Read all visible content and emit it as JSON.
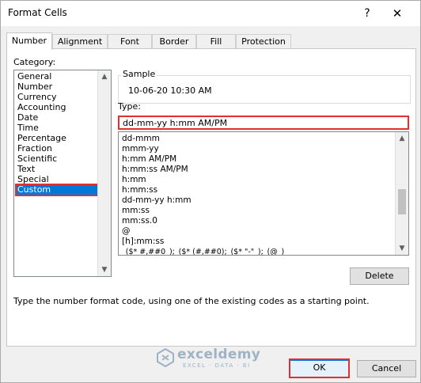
{
  "window": {
    "title": "Format Cells",
    "help": "?",
    "close": "✕"
  },
  "tabs": [
    {
      "label": "Number",
      "active": true
    },
    {
      "label": "Alignment"
    },
    {
      "label": "Font"
    },
    {
      "label": "Border"
    },
    {
      "label": "Fill"
    },
    {
      "label": "Protection"
    }
  ],
  "category": {
    "label": "Category:",
    "items": [
      "General",
      "Number",
      "Currency",
      "Accounting",
      "Date",
      "Time",
      "Percentage",
      "Fraction",
      "Scientific",
      "Text",
      "Special",
      "Custom"
    ],
    "selected": "Custom"
  },
  "sample": {
    "label": "Sample",
    "value": "10-06-20 10:30 AM"
  },
  "type": {
    "label": "Type:",
    "value": "dd-mm-yy h:mm AM/PM",
    "list": [
      "dd-mmm",
      "mmm-yy",
      "h:mm AM/PM",
      "h:mm:ss AM/PM",
      "h:mm",
      "h:mm:ss",
      "dd-mm-yy h:mm",
      "mm:ss",
      "mm:ss.0",
      "@",
      "[h]:mm:ss",
      "_($* #,##0_);_($* (#,##0);_($* \"-\"_);_(@_)"
    ]
  },
  "buttons": {
    "delete": "Delete",
    "ok": "OK",
    "cancel": "Cancel"
  },
  "hint": "Type the number format code, using one of the existing codes as a starting point.",
  "watermark": {
    "name": "exceldemy",
    "tagline": "EXCEL · DATA · BI"
  },
  "colors": {
    "selection": "#0078d7",
    "highlight": "#e03030",
    "watermark": "#9eb3c4"
  },
  "icons": {
    "scroll_up": "chevron-up-icon",
    "scroll_down": "chevron-down-icon"
  }
}
